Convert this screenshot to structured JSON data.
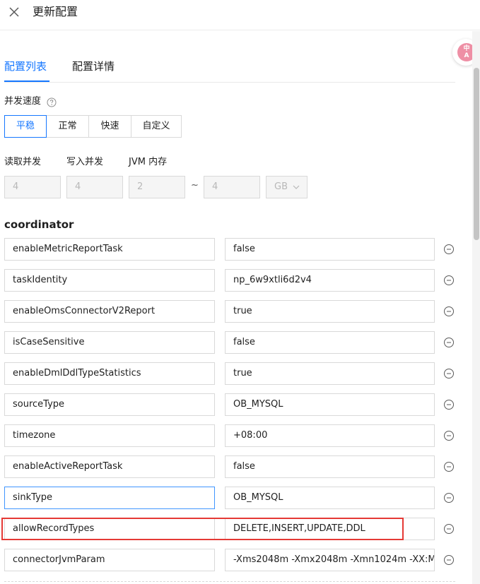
{
  "header": {
    "title": "更新配置"
  },
  "float_badge": {
    "top": "中",
    "bottom": "A"
  },
  "tabs": [
    {
      "label": "配置列表",
      "active": true
    },
    {
      "label": "配置详情",
      "active": false
    }
  ],
  "speed": {
    "label": "并发速度",
    "options": [
      "平稳",
      "正常",
      "快速",
      "自定义"
    ],
    "selected": "平稳"
  },
  "concurrency": {
    "read_label": "读取并发",
    "write_label": "写入并发",
    "jvm_label": "JVM 内存",
    "read_value": "4",
    "write_value": "4",
    "jvm_min": "2",
    "range_sep": "~",
    "jvm_max": "4",
    "unit": "GB"
  },
  "section": {
    "title": "coordinator"
  },
  "rows": [
    {
      "key": "enableMetricReportTask",
      "value": "false"
    },
    {
      "key": "taskIdentity",
      "value": "np_6w9xtli6d2v4"
    },
    {
      "key": "enableOmsConnectorV2Report",
      "value": "true"
    },
    {
      "key": "isCaseSensitive",
      "value": "false"
    },
    {
      "key": "enableDmlDdlTypeStatistics",
      "value": "true"
    },
    {
      "key": "sourceType",
      "value": "OB_MYSQL"
    },
    {
      "key": "timezone",
      "value": "+08:00"
    },
    {
      "key": "enableActiveReportTask",
      "value": "false"
    },
    {
      "key": "sinkType",
      "value": "OB_MYSQL"
    },
    {
      "key": "allowRecordTypes",
      "value": "DELETE,INSERT,UPDATE,DDL"
    },
    {
      "key": "connectorJvmParam",
      "value": "-Xms2048m -Xmx2048m -Xmn1024m -XX:M"
    }
  ]
}
